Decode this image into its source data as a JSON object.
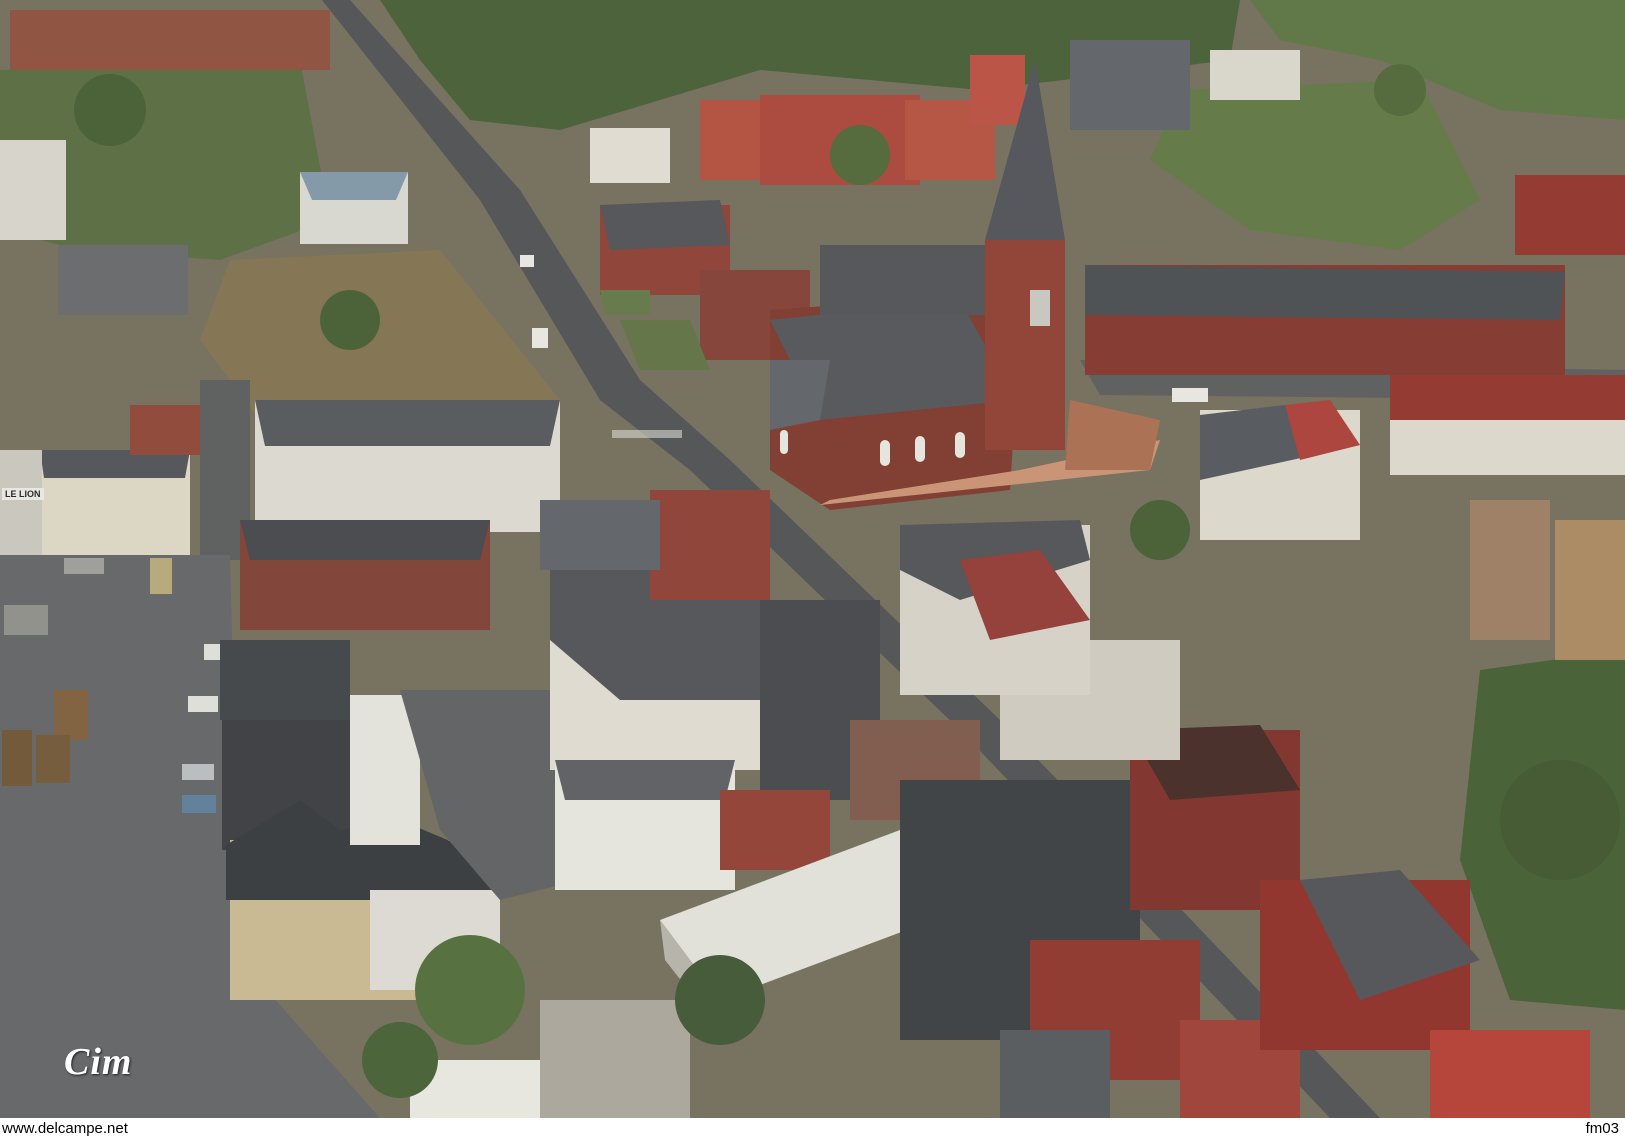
{
  "photo": {
    "subject": "aerial-view-village-church",
    "logo_text": "Cim",
    "shop_sign": "LE LION"
  },
  "footer": {
    "watermark_left": "www.delcampe.net",
    "watermark_right": "fm03"
  },
  "colors": {
    "road": "#4a4c50",
    "roof_slate": "#555a60",
    "roof_red": "#9c3a32",
    "brick": "#7a3a30",
    "greenery": "#4f6b3a",
    "plaza": "#5e6064"
  }
}
